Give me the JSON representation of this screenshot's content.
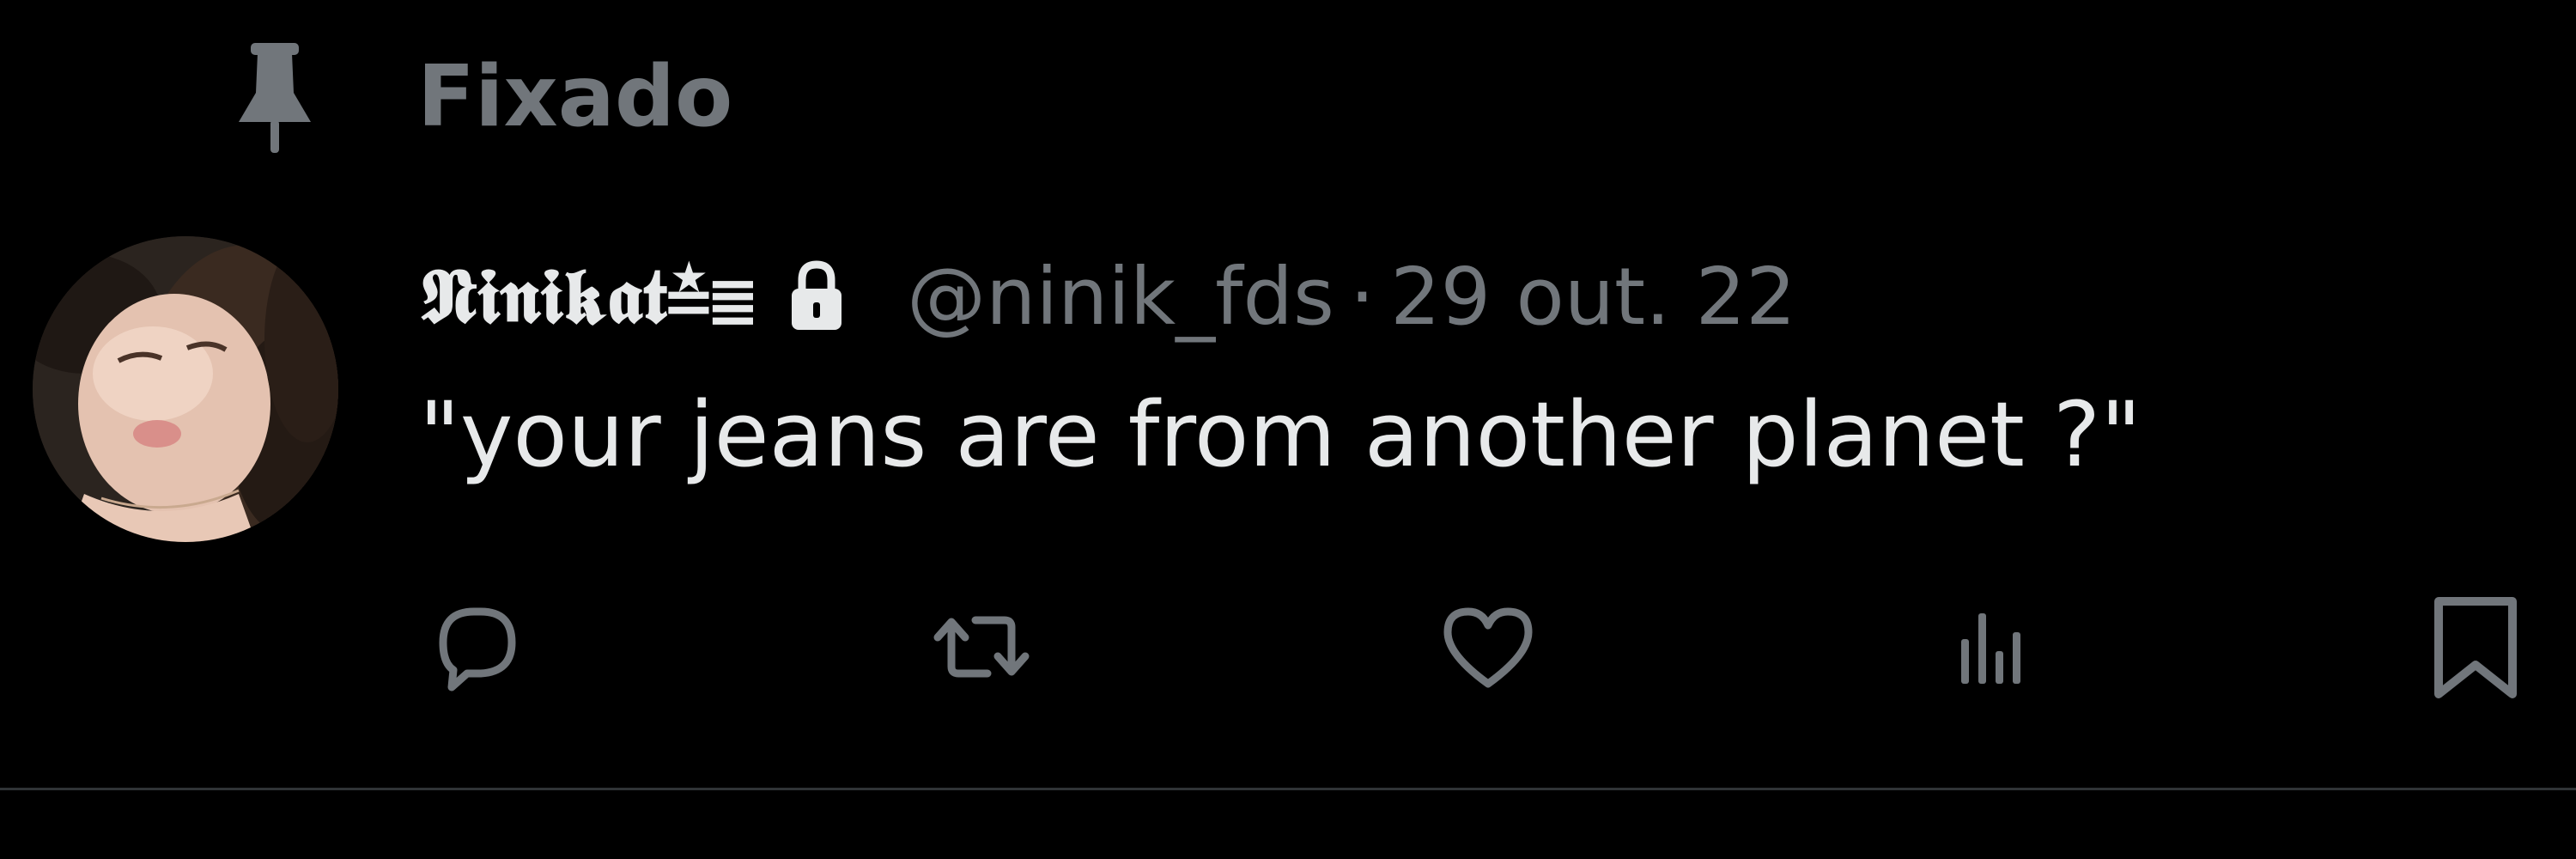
{
  "pinned": {
    "icon": "pin-icon",
    "label": "Fixado"
  },
  "author": {
    "display_name": "𝕹𝖎𝖓𝖎𝖐𝖆𝖙≛≣",
    "protected_icon": "lock-icon",
    "handle": "@ninik_fds",
    "separator": "·",
    "timestamp": "29 out. 22",
    "avatar": "profile-photo"
  },
  "tweet": {
    "text": "\"your jeans are from another planet ?\""
  },
  "actions": [
    {
      "name": "reply",
      "icon": "reply-icon"
    },
    {
      "name": "retweet",
      "icon": "retweet-icon"
    },
    {
      "name": "like",
      "icon": "heart-icon"
    },
    {
      "name": "views",
      "icon": "analytics-icon"
    },
    {
      "name": "bookmark",
      "icon": "bookmark-icon"
    }
  ],
  "colors": {
    "background": "#000000",
    "primary_text": "#e7e9ea",
    "secondary_text": "#71767b",
    "divider": "#2f3336"
  }
}
